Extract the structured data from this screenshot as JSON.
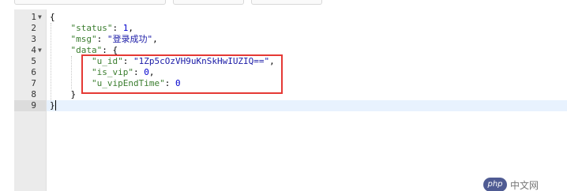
{
  "editor": {
    "line_numbers": [
      "1",
      "2",
      "3",
      "4",
      "5",
      "6",
      "7",
      "8",
      "9"
    ],
    "active_line": "9",
    "lines": [
      [
        {
          "t": "{",
          "c": "punc"
        }
      ],
      [
        {
          "t": "    ",
          "c": "punc"
        },
        {
          "t": "\"status\"",
          "c": "kq"
        },
        {
          "t": ": ",
          "c": "punc"
        },
        {
          "t": "1",
          "c": "num"
        },
        {
          "t": ",",
          "c": "punc"
        }
      ],
      [
        {
          "t": "    ",
          "c": "punc"
        },
        {
          "t": "\"msg\"",
          "c": "kq"
        },
        {
          "t": ": ",
          "c": "punc"
        },
        {
          "t": "\"登录成功\"",
          "c": "str"
        },
        {
          "t": ",",
          "c": "punc"
        }
      ],
      [
        {
          "t": "    ",
          "c": "punc"
        },
        {
          "t": "\"data\"",
          "c": "kq"
        },
        {
          "t": ": {",
          "c": "punc"
        }
      ],
      [
        {
          "t": "        ",
          "c": "punc"
        },
        {
          "t": "\"u_id\"",
          "c": "kq"
        },
        {
          "t": ": ",
          "c": "punc"
        },
        {
          "t": "\"1Zp5cOzVH9uKnSkHwIUZIQ==\"",
          "c": "str"
        },
        {
          "t": ",",
          "c": "punc"
        }
      ],
      [
        {
          "t": "        ",
          "c": "punc"
        },
        {
          "t": "\"is_vip\"",
          "c": "kq"
        },
        {
          "t": ": ",
          "c": "punc"
        },
        {
          "t": "0",
          "c": "num"
        },
        {
          "t": ",",
          "c": "punc"
        }
      ],
      [
        {
          "t": "        ",
          "c": "punc"
        },
        {
          "t": "\"u_vipEndTime\"",
          "c": "kq"
        },
        {
          "t": ": ",
          "c": "punc"
        },
        {
          "t": "0",
          "c": "num"
        }
      ],
      [
        {
          "t": "    }",
          "c": "punc"
        }
      ],
      [
        {
          "t": "}",
          "c": "punc"
        }
      ]
    ],
    "foldable_lines": [
      "1",
      "4"
    ],
    "fold_icon": "triangle-down-icon"
  },
  "highlight": {
    "color": "#e53935"
  },
  "watermark": {
    "logo_text": "php",
    "text": "中文网"
  },
  "colors": {
    "key": "#3a7d2e",
    "string": "#1a1aa6",
    "number": "#0000cd",
    "active_line_bg": "#e8f2fe",
    "gutter_bg": "#ebebeb"
  }
}
